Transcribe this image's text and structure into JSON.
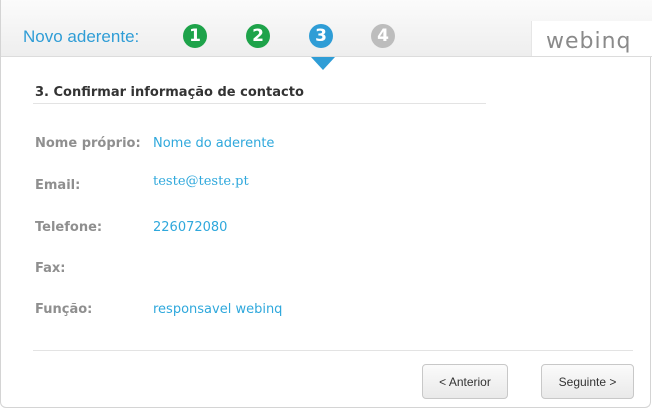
{
  "header": {
    "title": "Novo aderente:",
    "steps": [
      {
        "number": "1",
        "state": "completed",
        "color": "#1ea34a"
      },
      {
        "number": "2",
        "state": "completed",
        "color": "#1ea34a"
      },
      {
        "number": "3",
        "state": "active",
        "color": "#2f9dd6"
      },
      {
        "number": "4",
        "state": "pending",
        "color": "#bdbdbd"
      }
    ],
    "logo_text": "webinq"
  },
  "section": {
    "title": "3. Confirmar informação de contacto"
  },
  "fields": {
    "name": {
      "label": "Nome próprio:",
      "value": "Nome do aderente"
    },
    "email": {
      "label": "Email:",
      "value": "teste@teste.pt"
    },
    "phone": {
      "label": "Telefone:",
      "value": "226072080"
    },
    "fax": {
      "label": "Fax:",
      "value": ""
    },
    "role": {
      "label": "Função:",
      "value": "responsavel webinq"
    }
  },
  "buttons": {
    "previous": "< Anterior",
    "next": "Seguinte >"
  }
}
